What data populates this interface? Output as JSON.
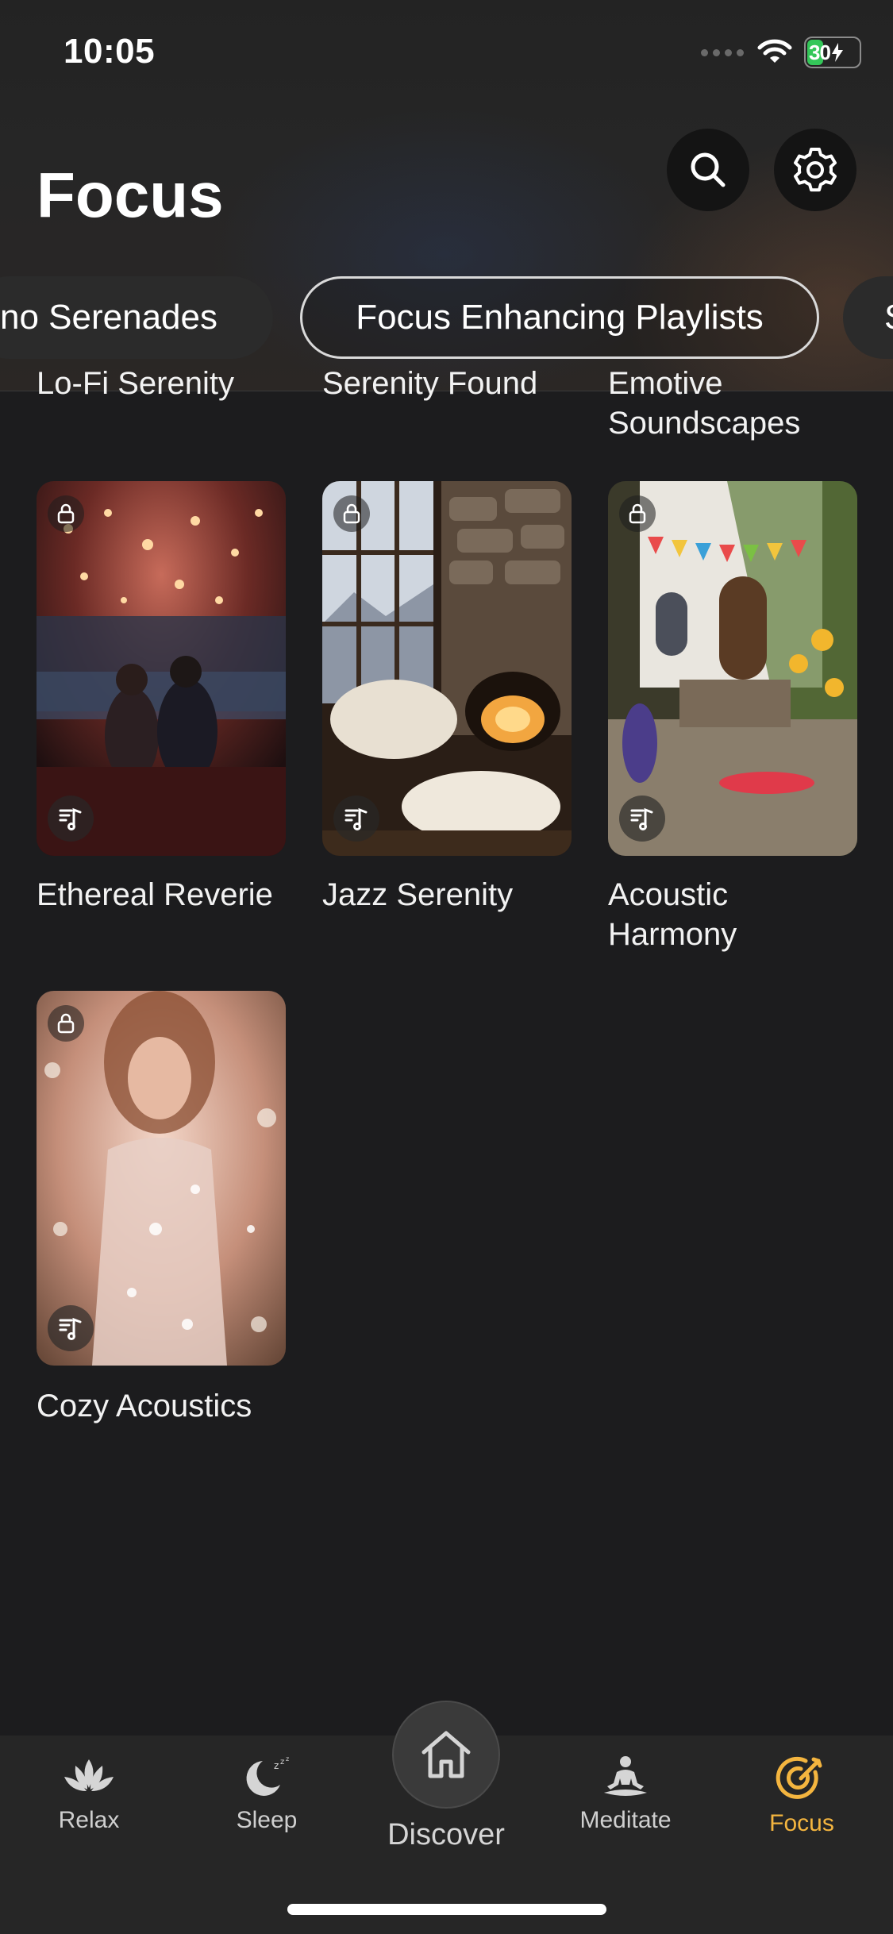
{
  "status": {
    "time": "10:05",
    "battery": "30"
  },
  "header": {
    "title": "Focus"
  },
  "chips": [
    {
      "label": "no Serenades",
      "active": false
    },
    {
      "label": "Focus Enhancing Playlists",
      "active": true
    },
    {
      "label": "S",
      "active": false
    }
  ],
  "partial_titles": [
    "Lo-Fi Serenity",
    "Serenity Found",
    "Emotive",
    "Soundscapes"
  ],
  "cards": [
    {
      "title": "Ethereal Reverie",
      "locked": true
    },
    {
      "title": "Jazz Serenity",
      "locked": true
    },
    {
      "title": "Acoustic",
      "title2": "Harmony",
      "locked": true
    },
    {
      "title": "Cozy Acoustics",
      "locked": true
    }
  ],
  "nav": {
    "relax": "Relax",
    "sleep": "Sleep",
    "discover": "Discover",
    "meditate": "Meditate",
    "focus": "Focus"
  },
  "colors": {
    "accent": "#f4b53f",
    "background": "#1c1c1e",
    "battery": "#34c759"
  }
}
